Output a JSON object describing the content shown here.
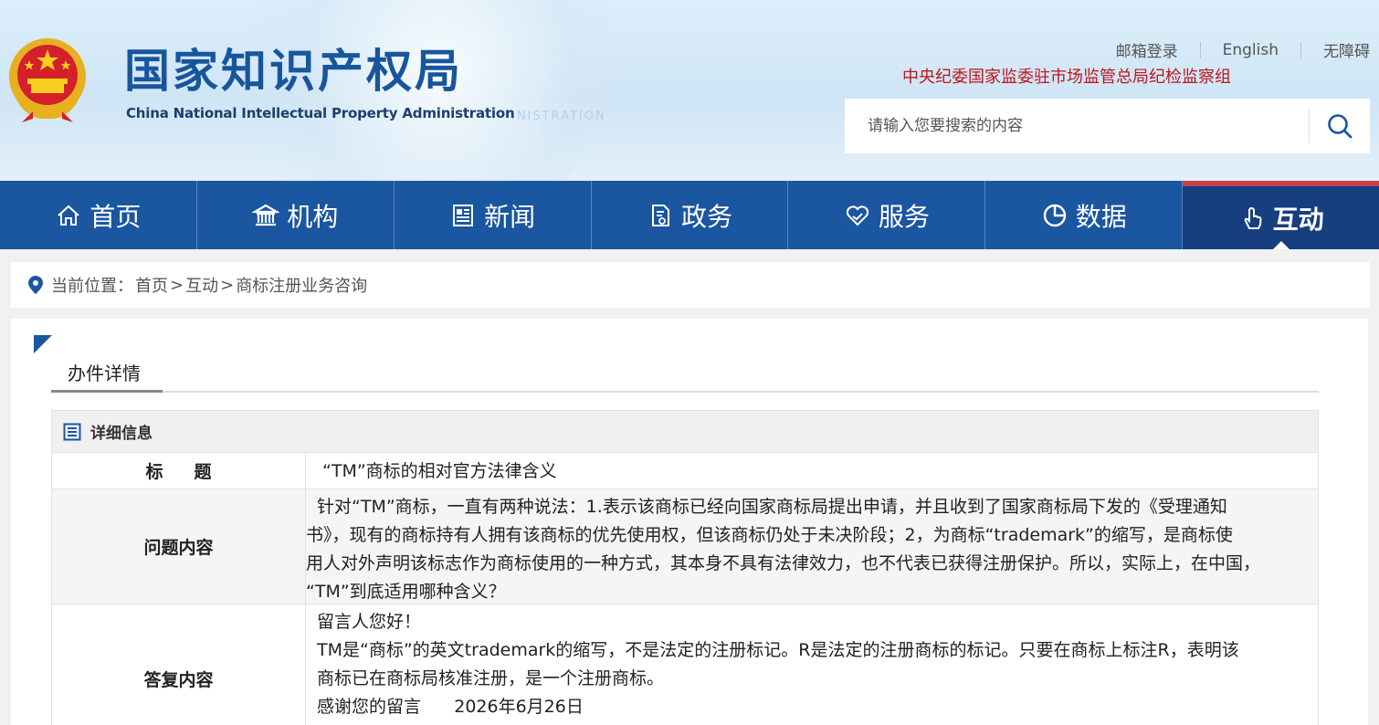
{
  "header": {
    "logo_cn": "国家知识产权局",
    "logo_en": "China National Intellectual Property Administration",
    "ghost_text": "INISTRATION",
    "top_links": [
      "邮箱登录",
      "English",
      "无障碍"
    ],
    "discipline_link": "中央纪委国家监委驻市场监管总局纪检监察组",
    "search_placeholder": "请输入您要搜索的内容"
  },
  "nav": {
    "items": [
      {
        "label": "首页",
        "icon": "home-icon"
      },
      {
        "label": "机构",
        "icon": "institution-icon"
      },
      {
        "label": "新闻",
        "icon": "news-icon"
      },
      {
        "label": "政务",
        "icon": "document-icon"
      },
      {
        "label": "服务",
        "icon": "heart-hand-icon"
      },
      {
        "label": "数据",
        "icon": "pie-chart-icon"
      },
      {
        "label": "互动",
        "icon": "hand-pointer-icon"
      }
    ],
    "active_index": 6
  },
  "breadcrumb": {
    "prefix": "当前位置：",
    "items": [
      "首页",
      ">",
      "互动",
      ">",
      "商标注册业务咨询"
    ]
  },
  "tab": {
    "label": "办件详情"
  },
  "detail": {
    "header": "详细信息",
    "title_label": "标题",
    "title_value": "“TM”商标的相对官方法律含义",
    "question_label": "问题内容",
    "question_line1": "针对“TM”商标，一直有两种说法：1.表示该商标已经向国家商标局提出申请，并且收到了国家商标局下发的《受理通知",
    "question_line2": "书》，现有的商标持有人拥有该商标的优先使用权，但该商标仍处于未决阶段；2，为商标“trademark”的缩写，是商标使",
    "question_line3": "用人对外声明该标志作为商标使用的一种方式，其本身不具有法律效力，也不代表已获得注册保护。所以，实际上，在中国，",
    "question_line4": "“TM”到底适用哪种含义？",
    "answer_label": "答复内容",
    "answer_line1": "留言人您好！",
    "answer_line2": "TM是“商标”的英文trademark的缩写，不是法定的注册标记。R是法定的注册商标的标记。只要在商标上标注R，表明该",
    "answer_line3": "商标已在商标局核准注册，是一个注册商标。",
    "answer_line4": "感谢您的留言      2026年6月26日"
  },
  "colors": {
    "nav_bg": "#1b56a0",
    "nav_active_bg": "#173f7f",
    "nav_active_top": "#c7414a",
    "logo_blue": "#18569c",
    "discipline_red": "#c0141c"
  }
}
